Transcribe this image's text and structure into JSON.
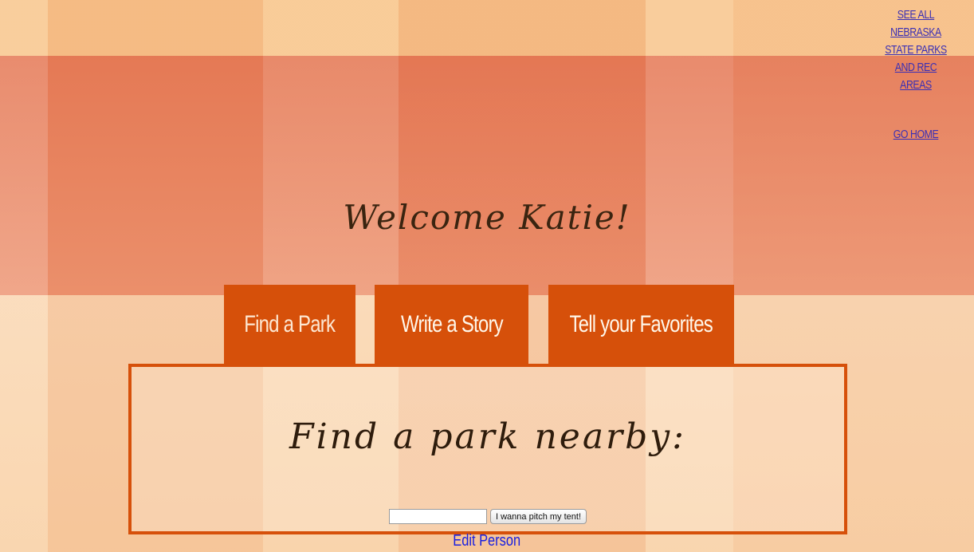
{
  "nav": {
    "all_parks_link": "SEE ALL NEBRASKA STATE PARKS AND REC AREAS",
    "all_parks_lines": [
      "SEE ALL",
      "NEBRASKA",
      "STATE PARKS",
      "AND REC AREAS"
    ],
    "go_home_link": "GO HOME"
  },
  "welcome": {
    "text": "Welcome Katie!"
  },
  "tabs": [
    {
      "label": "Find a Park"
    },
    {
      "label": "Write a Story"
    },
    {
      "label": "Tell your Favorites"
    }
  ],
  "panel": {
    "heading": "Find a park nearby:",
    "search_value": "",
    "button_label": "I wanna pitch my tent!"
  },
  "footer": {
    "edit_link": "Edit Person"
  },
  "colors": {
    "accent": "#d6500a",
    "link": "#3a2fb5",
    "heading_text": "#2e1c0c"
  }
}
